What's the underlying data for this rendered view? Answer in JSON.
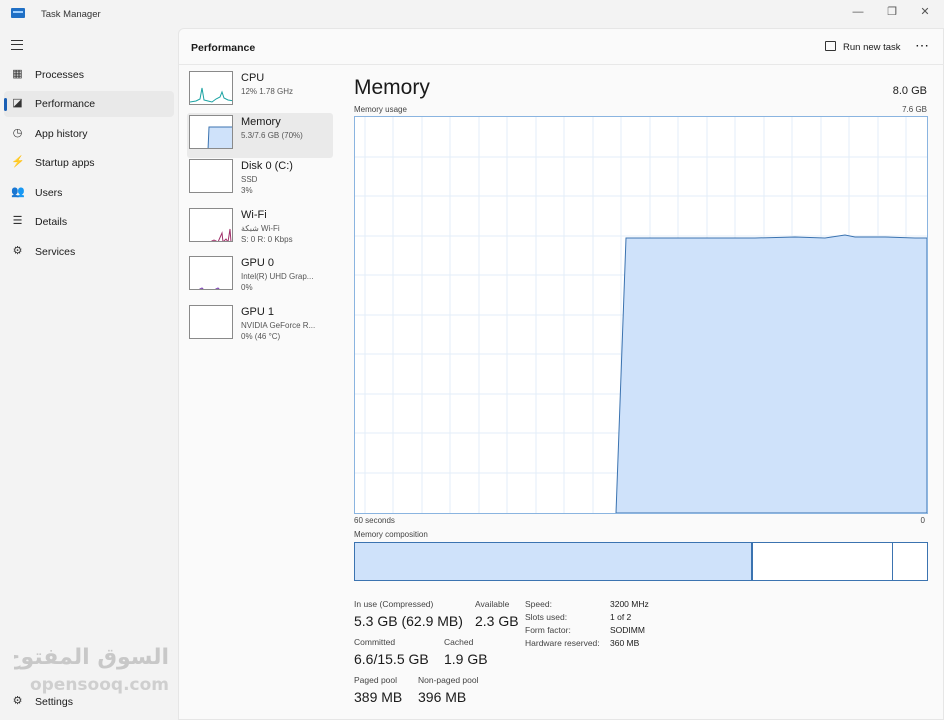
{
  "window": {
    "title": "Task Manager",
    "minimize": "—",
    "maximize": "❐",
    "close": "✕"
  },
  "sidebar": {
    "items": [
      {
        "label": "Processes",
        "icon": "processes-icon"
      },
      {
        "label": "Performance",
        "icon": "performance-icon"
      },
      {
        "label": "App history",
        "icon": "app-history-icon"
      },
      {
        "label": "Startup apps",
        "icon": "startup-apps-icon"
      },
      {
        "label": "Users",
        "icon": "users-icon"
      },
      {
        "label": "Details",
        "icon": "details-icon"
      },
      {
        "label": "Services",
        "icon": "services-icon"
      }
    ],
    "settings": "Settings"
  },
  "header": {
    "title": "Performance",
    "run_task": "Run new task",
    "more": "⋯"
  },
  "devices": [
    {
      "name": "CPU",
      "sub1": "12%  1.78 GHz",
      "sub2": ""
    },
    {
      "name": "Memory",
      "sub1": "5.3/7.6 GB (70%)",
      "sub2": ""
    },
    {
      "name": "Disk 0 (C:)",
      "sub1": "SSD",
      "sub2": "3%"
    },
    {
      "name": "Wi-Fi",
      "sub1": "شبكة Wi-Fi",
      "sub2": "S: 0 R: 0 Kbps"
    },
    {
      "name": "GPU 0",
      "sub1": "Intel(R) UHD Grap...",
      "sub2": "0%"
    },
    {
      "name": "GPU 1",
      "sub1": "NVIDIA GeForce R...",
      "sub2": "0%  (46 °C)"
    }
  ],
  "memory": {
    "title": "Memory",
    "total": "8.0 GB",
    "usage_label": "Memory usage",
    "usage_max": "7.6 GB",
    "time_left": "60 seconds",
    "time_right": "0",
    "composition_label": "Memory composition",
    "stats": {
      "in_use_label": "In use (Compressed)",
      "in_use": "5.3 GB (62.9 MB)",
      "available_label": "Available",
      "available": "2.3 GB",
      "committed_label": "Committed",
      "committed": "6.6/15.5 GB",
      "cached_label": "Cached",
      "cached": "1.9 GB",
      "paged_label": "Paged pool",
      "paged": "389 MB",
      "nonpaged_label": "Non-paged pool",
      "nonpaged": "396 MB"
    },
    "details": [
      {
        "key": "Speed:",
        "value": "3200 MHz"
      },
      {
        "key": "Slots used:",
        "value": "1 of 2"
      },
      {
        "key": "Form factor:",
        "value": "SODIMM"
      },
      {
        "key": "Hardware reserved:",
        "value": "360 MB"
      }
    ]
  },
  "watermark": "السوق المفتوح opensooq.com",
  "colors": {
    "accent": "#1a5fb4",
    "graph_fill": "#cfe2fa",
    "graph_line": "#3b73b0"
  }
}
